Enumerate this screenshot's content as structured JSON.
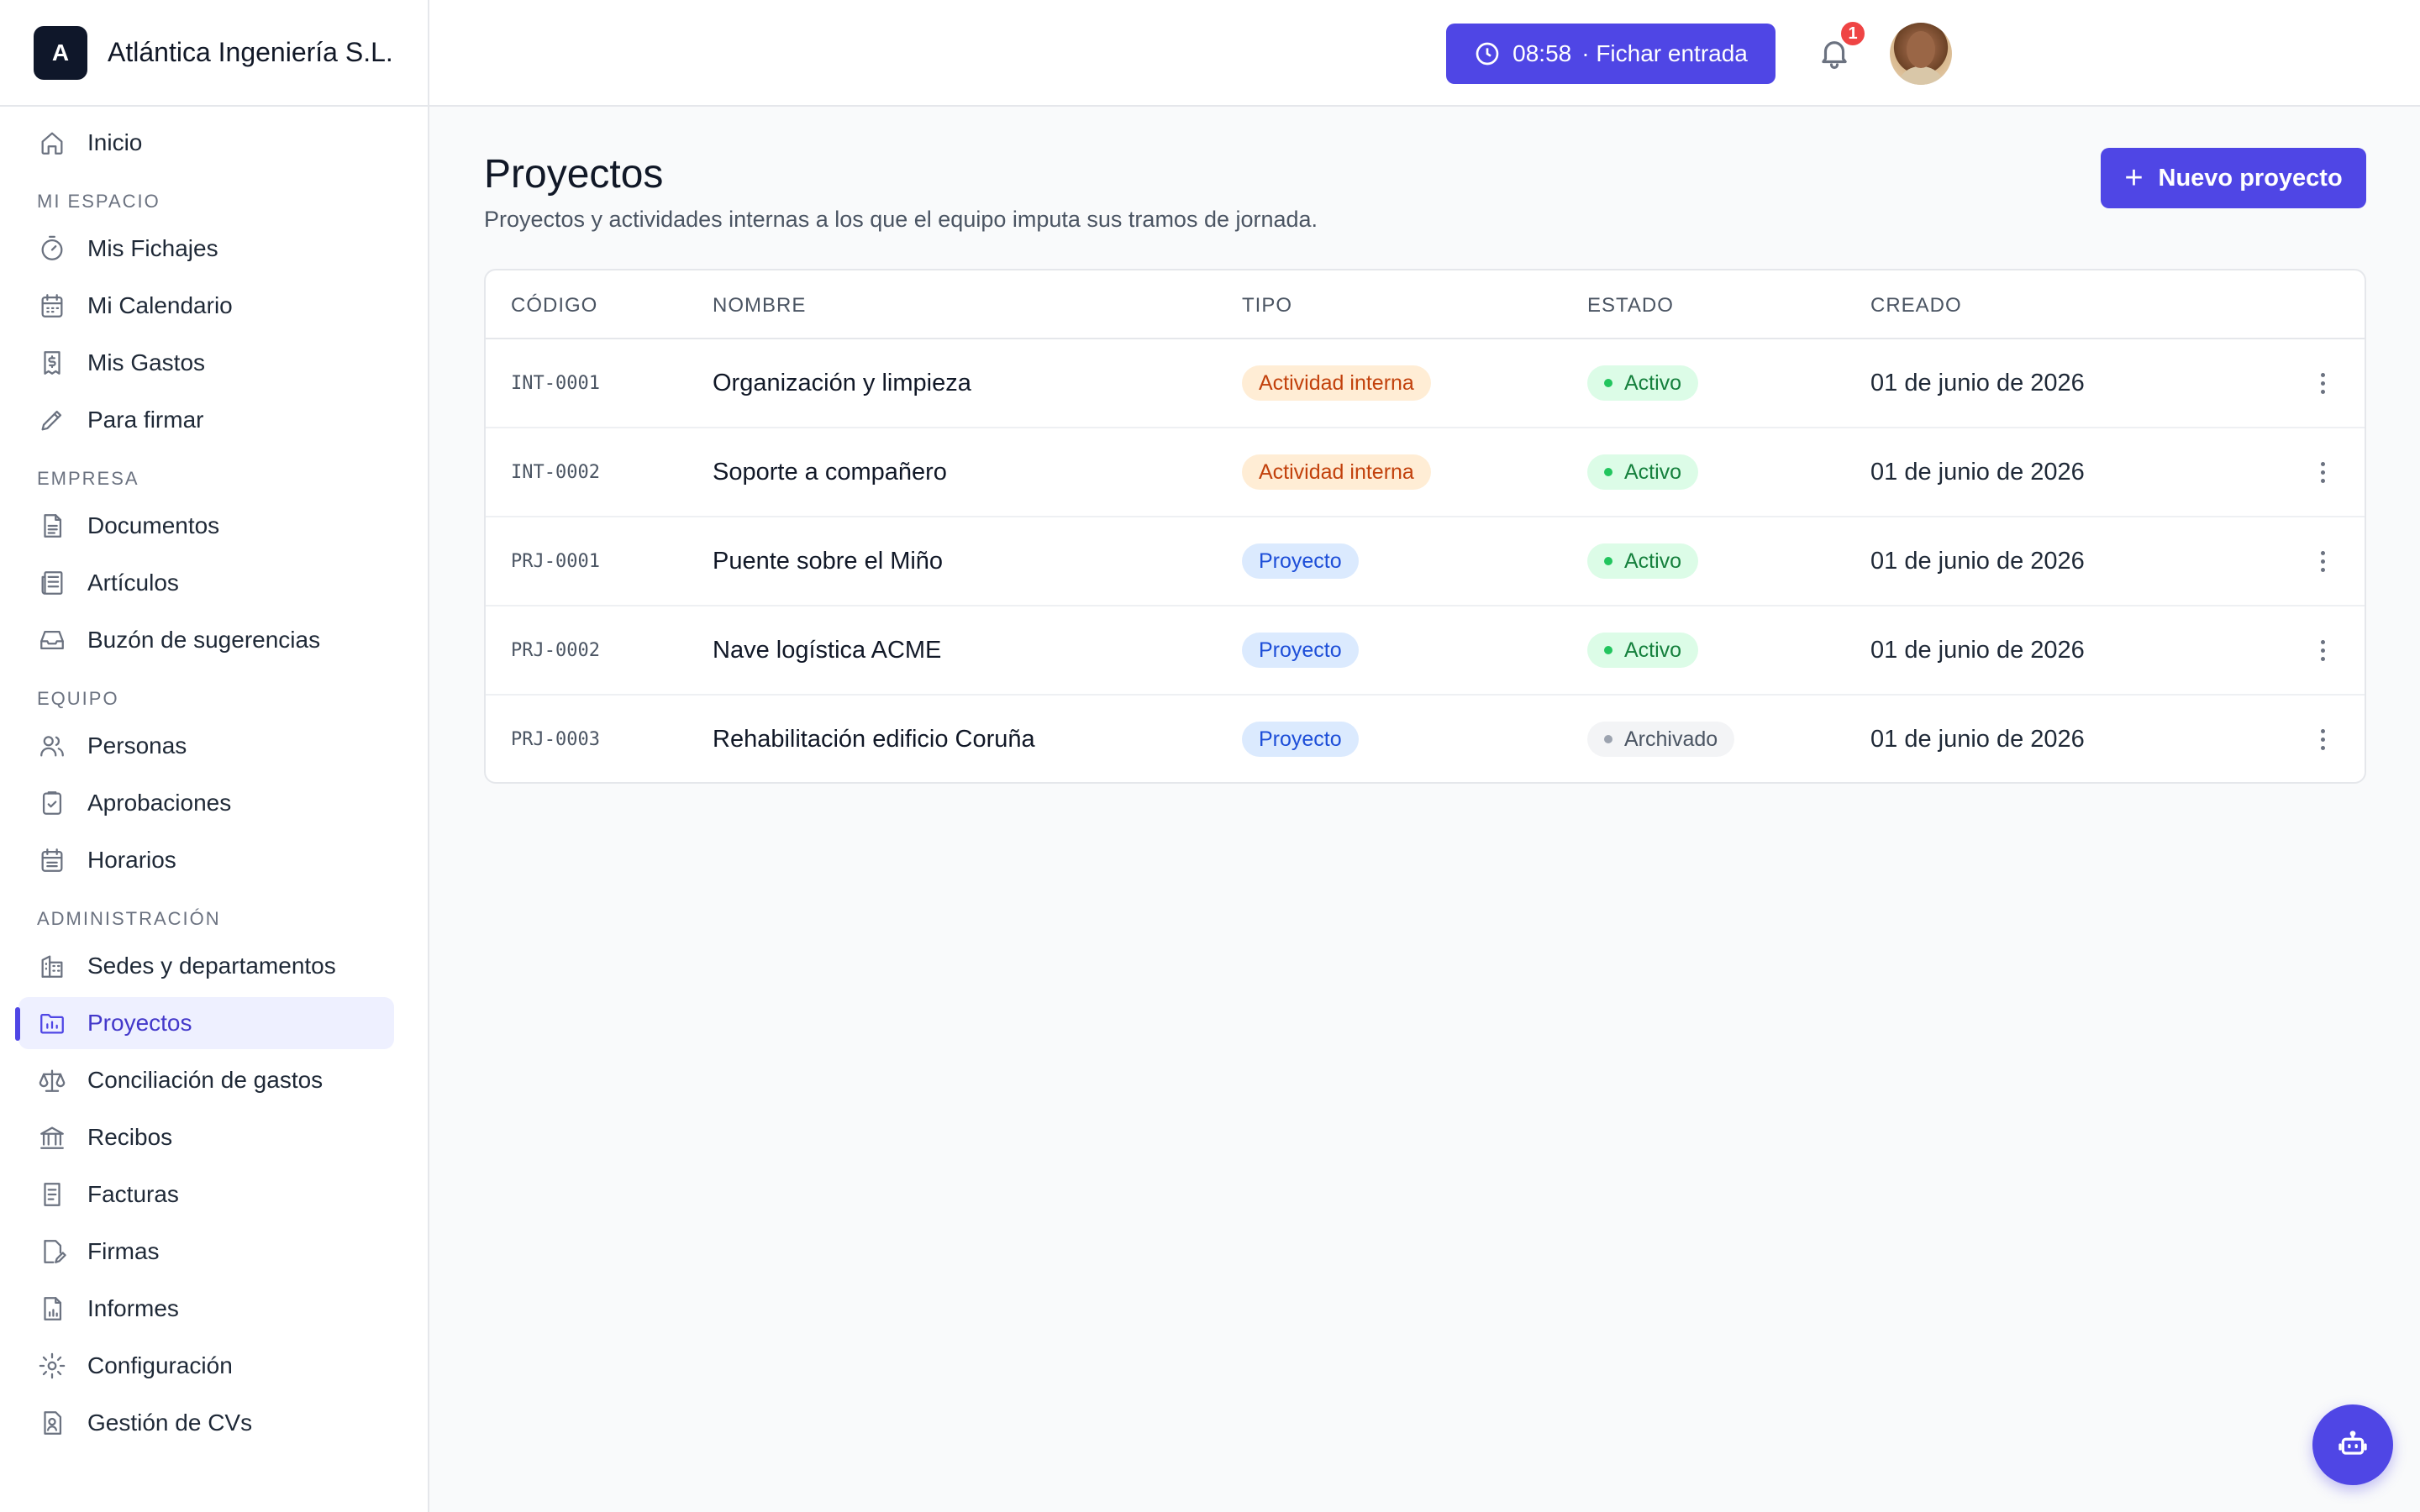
{
  "brand": {
    "logo_letter": "A",
    "name": "Atlántica Ingeniería S.L."
  },
  "topbar": {
    "clock_time": "08:58",
    "clock_label": "· Fichar entrada",
    "notifications_count": "1"
  },
  "sidebar": {
    "home": {
      "label": "Inicio",
      "icon": "home-icon"
    },
    "sections": [
      {
        "title": "MI ESPACIO",
        "items": [
          {
            "label": "Mis Fichajes",
            "icon": "stopwatch-icon"
          },
          {
            "label": "Mi Calendario",
            "icon": "calendar-icon"
          },
          {
            "label": "Mis Gastos",
            "icon": "receipt-dollar-icon"
          },
          {
            "label": "Para firmar",
            "icon": "pen-icon"
          }
        ]
      },
      {
        "title": "EMPRESA",
        "items": [
          {
            "label": "Documentos",
            "icon": "document-icon"
          },
          {
            "label": "Artículos",
            "icon": "newspaper-icon"
          },
          {
            "label": "Buzón de sugerencias",
            "icon": "inbox-icon"
          }
        ]
      },
      {
        "title": "EQUIPO",
        "items": [
          {
            "label": "Personas",
            "icon": "users-icon"
          },
          {
            "label": "Aprobaciones",
            "icon": "clipboard-check-icon"
          },
          {
            "label": "Horarios",
            "icon": "calendar-grid-icon"
          }
        ]
      },
      {
        "title": "ADMINISTRACIÓN",
        "items": [
          {
            "label": "Sedes y departamentos",
            "icon": "building-icon"
          },
          {
            "label": "Proyectos",
            "icon": "folder-chart-icon",
            "active": true
          },
          {
            "label": "Conciliación de gastos",
            "icon": "scale-icon"
          },
          {
            "label": "Recibos",
            "icon": "bank-icon"
          },
          {
            "label": "Facturas",
            "icon": "invoice-icon"
          },
          {
            "label": "Firmas",
            "icon": "signature-icon"
          },
          {
            "label": "Informes",
            "icon": "report-icon"
          },
          {
            "label": "Configuración",
            "icon": "gear-icon"
          },
          {
            "label": "Gestión de CVs",
            "icon": "cv-icon"
          }
        ]
      }
    ]
  },
  "main": {
    "title": "Proyectos",
    "subtitle": "Proyectos y actividades internas a los que el equipo imputa sus tramos de jornada.",
    "new_button": "Nuevo proyecto",
    "columns": [
      "CÓDIGO",
      "NOMBRE",
      "TIPO",
      "ESTADO",
      "CREADO"
    ],
    "rows": [
      {
        "code": "INT-0001",
        "name": "Organización y limpieza",
        "type": "Actividad interna",
        "type_kind": "internal",
        "status": "Activo",
        "status_kind": "active",
        "created": "01 de junio de 2026"
      },
      {
        "code": "INT-0002",
        "name": "Soporte a compañero",
        "type": "Actividad interna",
        "type_kind": "internal",
        "status": "Activo",
        "status_kind": "active",
        "created": "01 de junio de 2026"
      },
      {
        "code": "PRJ-0001",
        "name": "Puente sobre el Miño",
        "type": "Proyecto",
        "type_kind": "project",
        "status": "Activo",
        "status_kind": "active",
        "created": "01 de junio de 2026"
      },
      {
        "code": "PRJ-0002",
        "name": "Nave logística ACME",
        "type": "Proyecto",
        "type_kind": "project",
        "status": "Activo",
        "status_kind": "active",
        "created": "01 de junio de 2026"
      },
      {
        "code": "PRJ-0003",
        "name": "Rehabilitación edificio Coruña",
        "type": "Proyecto",
        "type_kind": "project",
        "status": "Archivado",
        "status_kind": "archived",
        "created": "01 de junio de 2026"
      }
    ]
  },
  "colors": {
    "accent": "#4f46e5",
    "internal_badge": "#ffedd5",
    "project_badge": "#dbeafe",
    "active_badge": "#dcfce7"
  }
}
